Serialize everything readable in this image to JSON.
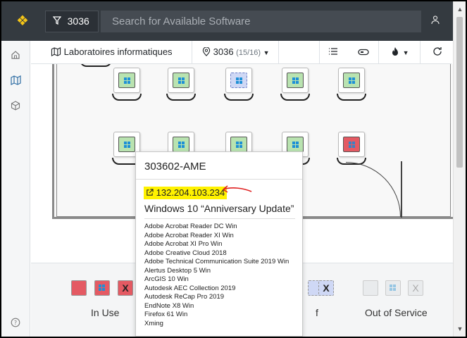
{
  "header": {
    "filter_icon": "filter-icon",
    "filter_value": "3036",
    "search_placeholder": "Search for Available Software",
    "user_icon": "user-icon",
    "logo_icon": "diamond-logo-icon"
  },
  "sidebar": {
    "items": [
      {
        "name": "home",
        "icon": "home-icon"
      },
      {
        "name": "map",
        "icon": "map-icon"
      },
      {
        "name": "package",
        "icon": "package-icon"
      }
    ],
    "help_icon": "help-icon"
  },
  "toolbar": {
    "breadcrumb": "Laboratoires informatiques",
    "room": "3036",
    "room_count": "(15/16)",
    "list_icon": "list-icon",
    "toggle_icon": "toggle-icon",
    "fire_icon": "fire-icon",
    "refresh_icon": "refresh-icon"
  },
  "map": {
    "rows": [
      [
        "free",
        "free",
        "busy",
        "free",
        "free"
      ],
      [
        "free",
        "free",
        "free",
        "free",
        "off"
      ]
    ]
  },
  "legend": {
    "in_use": "In Use",
    "partial_suffix": "f",
    "out_of_service": "Out of Service"
  },
  "popover": {
    "title": "303602-AME",
    "ip": "132.204.103.234",
    "os": "Windows 10 “Anniversary Update”",
    "software": [
      "Adobe Acrobat Reader DC Win",
      "Adobe Acrobat Reader XI Win",
      "Adobe Acrobat XI Pro Win",
      "Adobe Creative Cloud 2018",
      "Adobe Technical Communication Suite 2019 Win",
      "Alertus Desktop 5 Win",
      "ArcGIS 10 Win",
      "Autodesk AEC Collection 2019",
      "Autodesk ReCap Pro 2019",
      "EndNote X8 Win",
      "Firefox 61 Win",
      "Xming"
    ]
  },
  "colors": {
    "header_bg": "#343a40",
    "free": "#b9e3b0",
    "busy": "#cfd8f5",
    "off": "#e45a63",
    "highlight": "#fff200",
    "annotation_arrow": "#e02020"
  }
}
